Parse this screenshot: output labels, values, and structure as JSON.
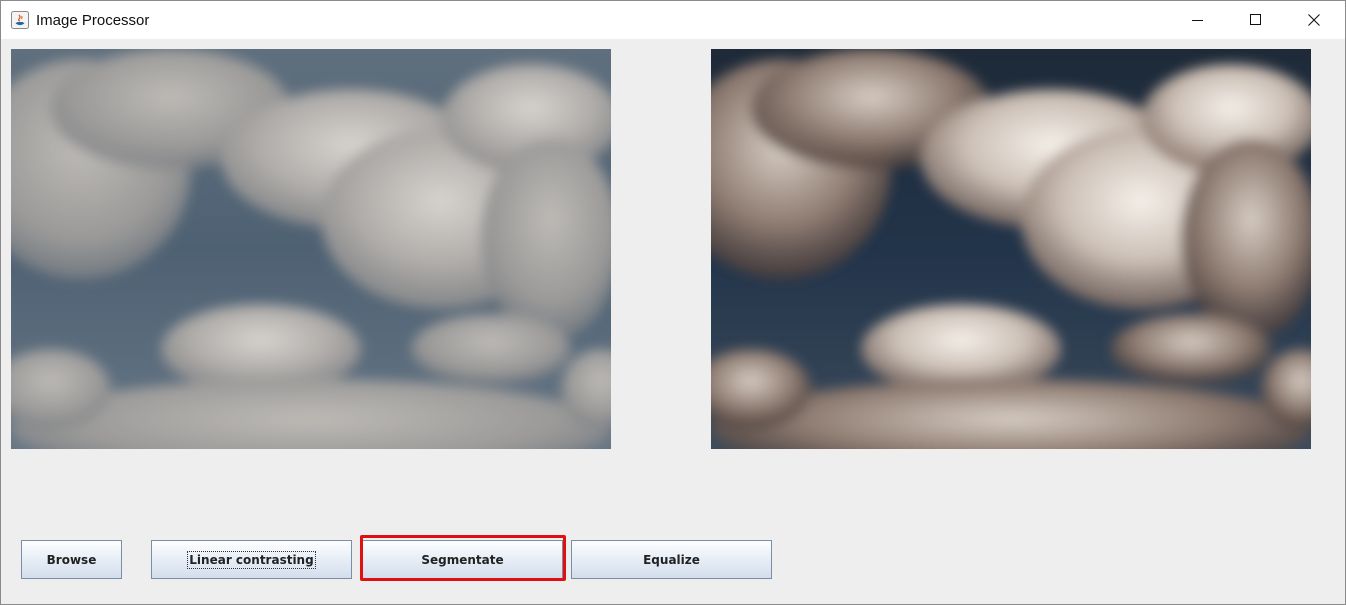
{
  "window": {
    "title": "Image Processor",
    "controls": {
      "minimize_icon": "minimize-icon",
      "maximize_icon": "maximize-icon",
      "close_icon": "close-icon"
    }
  },
  "images": {
    "original_icon": "image-original",
    "processed_icon": "image-processed"
  },
  "buttons": {
    "browse": "Browse",
    "linear_contrasting": "Linear contrasting",
    "segmentate": "Segmentate",
    "equalize": "Equalize"
  },
  "colors": {
    "window_bg": "#eeeeee",
    "titlebar_bg": "#ffffff",
    "highlight": "#e01010",
    "button_border": "#7b8ea8"
  }
}
